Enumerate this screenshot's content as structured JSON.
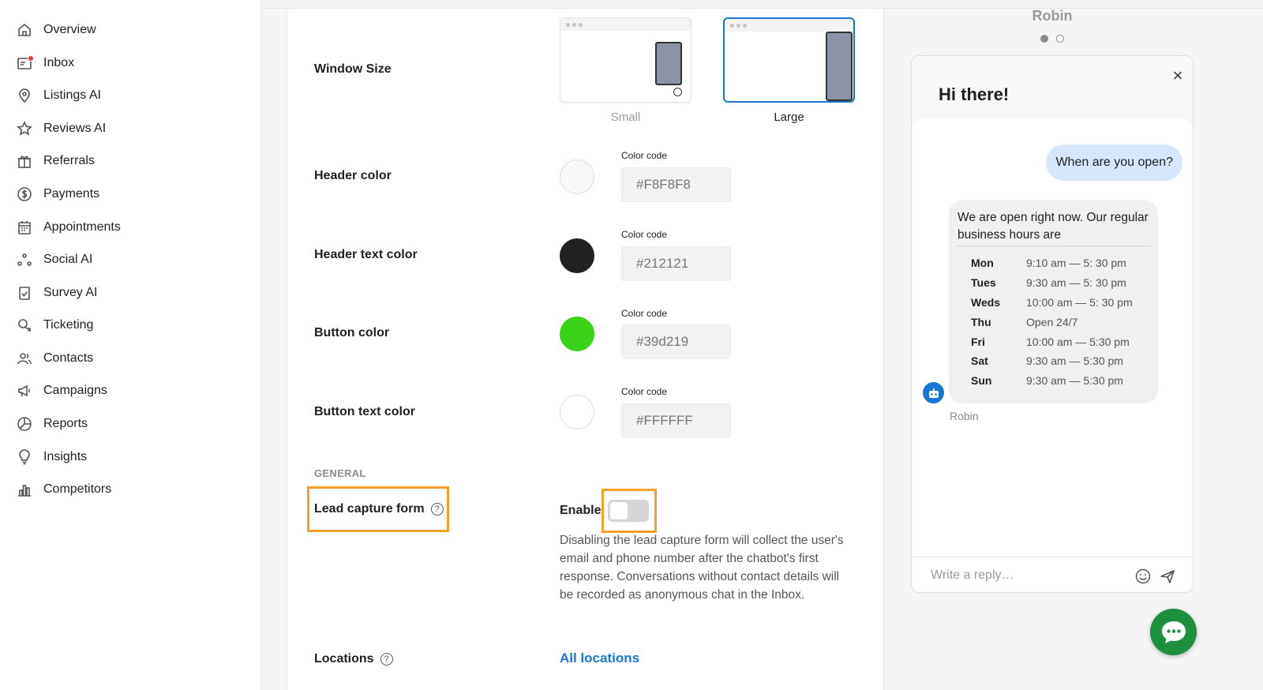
{
  "sidebar": {
    "items": [
      {
        "label": "Overview",
        "icon": "home-icon"
      },
      {
        "label": "Inbox",
        "icon": "inbox-icon"
      },
      {
        "label": "Listings AI",
        "icon": "location-pin-icon"
      },
      {
        "label": "Reviews AI",
        "icon": "star-icon"
      },
      {
        "label": "Referrals",
        "icon": "gift-icon"
      },
      {
        "label": "Payments",
        "icon": "dollar-circle-icon"
      },
      {
        "label": "Appointments",
        "icon": "calendar-icon"
      },
      {
        "label": "Social AI",
        "icon": "share-nodes-icon"
      },
      {
        "label": "Survey AI",
        "icon": "clipboard-check-icon"
      },
      {
        "label": "Ticketing",
        "icon": "chat-bubbles-icon"
      },
      {
        "label": "Contacts",
        "icon": "users-icon"
      },
      {
        "label": "Campaigns",
        "icon": "megaphone-icon"
      },
      {
        "label": "Reports",
        "icon": "pie-chart-icon"
      },
      {
        "label": "Insights",
        "icon": "lightbulb-icon"
      },
      {
        "label": "Competitors",
        "icon": "bar-chart-icon"
      }
    ],
    "inbox_badge_color": "#e53935"
  },
  "settings": {
    "window_size": {
      "label": "Window Size",
      "options": [
        {
          "label": "Small",
          "selected": false
        },
        {
          "label": "Large",
          "selected": true
        }
      ]
    },
    "colors": [
      {
        "label": "Header color",
        "caption": "Color code",
        "value": "#F8F8F8",
        "swatch": "#F8F8F8"
      },
      {
        "label": "Header text color",
        "caption": "Color code",
        "value": "#212121",
        "swatch": "#212121"
      },
      {
        "label": "Button color",
        "caption": "Color code",
        "value": "#39d219",
        "swatch": "#39d219"
      },
      {
        "label": "Button text color",
        "caption": "Color code",
        "value": "#FFFFFF",
        "swatch": "#FFFFFF"
      }
    ],
    "general_caption": "GENERAL",
    "lead_capture": {
      "label": "Lead capture form",
      "toggle_label": "Enable",
      "enabled": false,
      "description": "Disabling the lead capture form will collect the user's email and phone number after the chatbot's first response. Conversations without contact details will be recorded as anonymous chat in the Inbox."
    },
    "locations": {
      "label": "Locations",
      "link": "All locations"
    },
    "accent_color": "#1976d2",
    "highlight_color": "#f5a02a"
  },
  "chat_preview": {
    "agent_name": "Robin",
    "greeting": "Hi there!",
    "user_message": "When are you open?",
    "bot_intro": "We are open right now. Our regular business hours are",
    "hours": [
      {
        "day": "Mon",
        "time": "9:10 am — 5: 30 pm"
      },
      {
        "day": "Tues",
        "time": "9:30 am — 5: 30 pm"
      },
      {
        "day": "Weds",
        "time": "10:00 am — 5: 30 pm"
      },
      {
        "day": "Thu",
        "time": "Open 24/7"
      },
      {
        "day": "Fri",
        "time": "10:00 am — 5:30 pm"
      },
      {
        "day": "Sat",
        "time": "9:30 am — 5:30 pm"
      },
      {
        "day": "Sun",
        "time": "9:30 am — 5:30 pm"
      }
    ],
    "bot_name": "Robin",
    "reply_placeholder": "Write a reply…",
    "fab_color": "#1e8f3f"
  }
}
